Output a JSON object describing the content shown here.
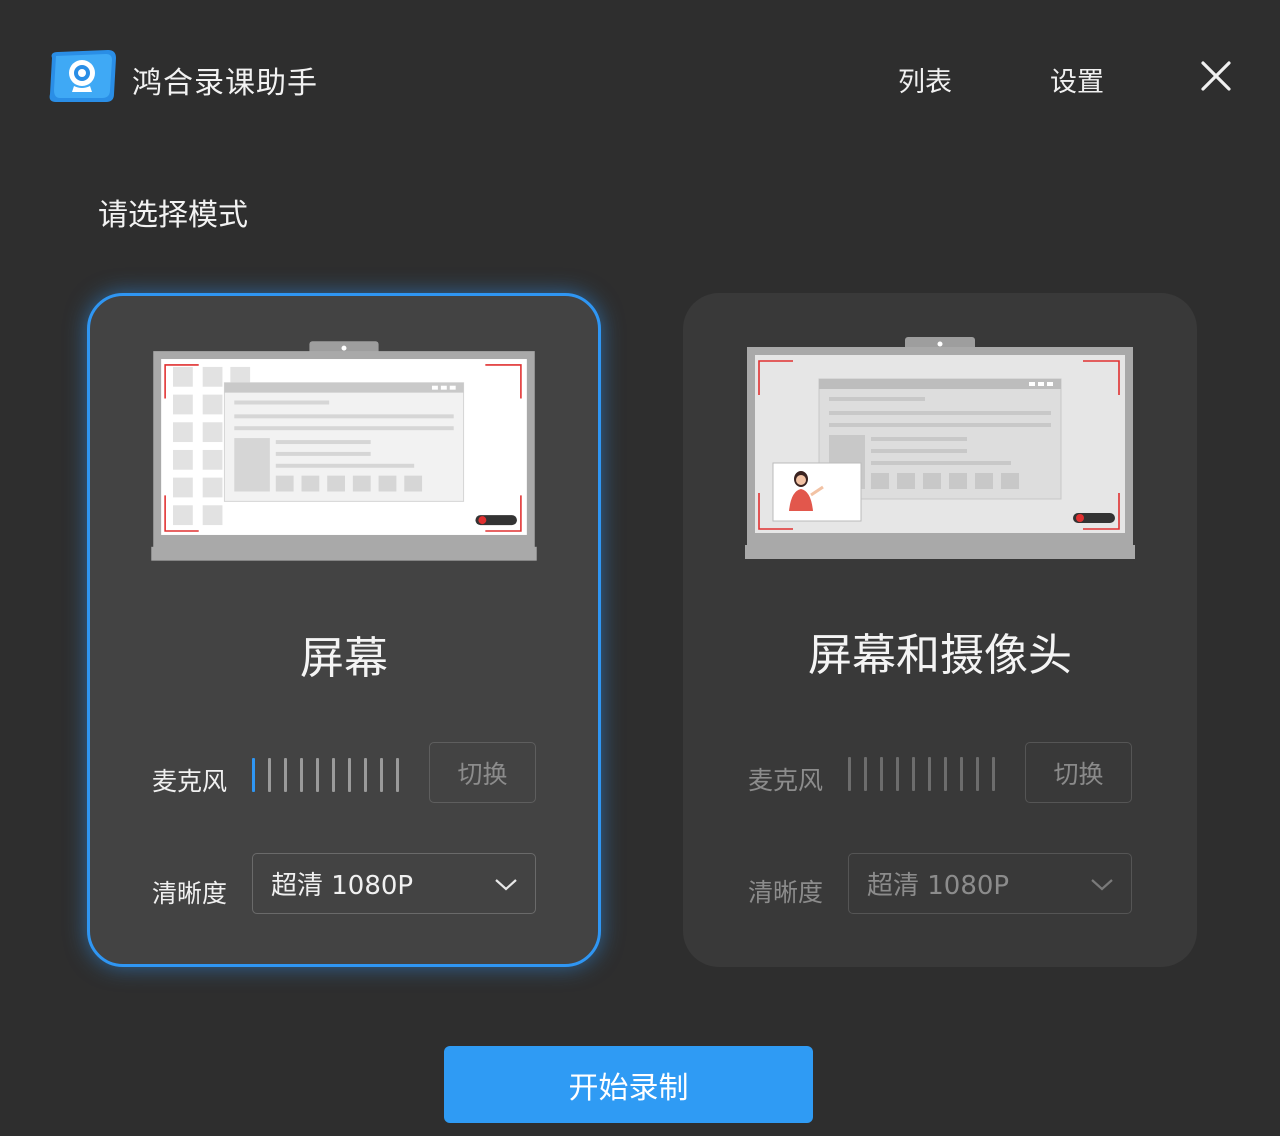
{
  "app": {
    "title": "鸿合录课助手",
    "logo_icon": "webcam-logo-icon"
  },
  "nav": {
    "list_label": "列表",
    "settings_label": "设置"
  },
  "prompt": "请选择模式",
  "modes": [
    {
      "title": "屏幕",
      "selected": true,
      "mic_label": "麦克风",
      "mic_level_bars_active": 1,
      "mic_bars_total": 10,
      "switch_label": "切换",
      "quality_label": "清晰度",
      "quality_value": "超清 1080P",
      "illustration_icon": "laptop-screen-recording-icon"
    },
    {
      "title": "屏幕和摄像头",
      "selected": false,
      "mic_label": "麦克风",
      "mic_level_bars_active": 0,
      "mic_bars_total": 10,
      "switch_label": "切换",
      "quality_label": "清晰度",
      "quality_value": "超清 1080P",
      "illustration_icon": "laptop-screen-camera-recording-icon"
    }
  ],
  "start_button_label": "开始录制",
  "colors": {
    "accent": "#2f96f3",
    "background": "#2e2e2e",
    "record_red": "#e03030"
  }
}
